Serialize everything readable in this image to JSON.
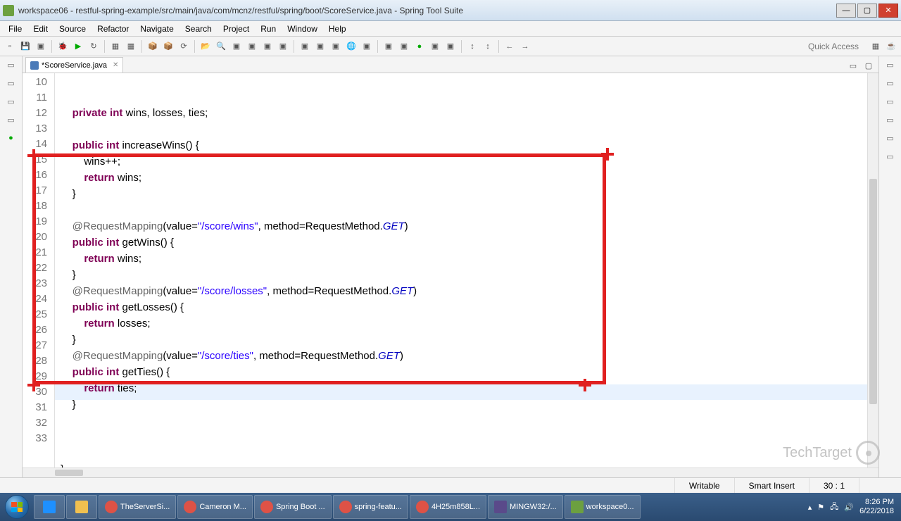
{
  "window": {
    "title": "workspace06 - restful-spring-example/src/main/java/com/mcnz/restful/spring/boot/ScoreService.java - Spring Tool Suite"
  },
  "menu": [
    "File",
    "Edit",
    "Source",
    "Refactor",
    "Navigate",
    "Search",
    "Project",
    "Run",
    "Window",
    "Help"
  ],
  "quick_access": "Quick Access",
  "tab": {
    "label": "*ScoreService.java"
  },
  "code": {
    "lines": [
      10,
      11,
      12,
      13,
      14,
      15,
      16,
      17,
      18,
      19,
      20,
      21,
      22,
      23,
      24,
      25,
      26,
      27,
      28,
      29,
      30,
      31,
      32,
      33
    ],
    "l10_a": "private",
    "l10_b": "int",
    "l10_c": " wins, losses, ties;",
    "l12_a": "public",
    "l12_b": "int",
    "l12_c": " increaseWins() {",
    "l13": "        wins++;",
    "l14_a": "return",
    "l14_b": " wins;",
    "l15": "    }",
    "l17_ann": "@RequestMapping",
    "l17_a": "(value=",
    "l17_s": "\"/score/wins\"",
    "l17_b": ", method=RequestMethod.",
    "l17_g": "GET",
    "l17_c": ")",
    "l18_a": "public",
    "l18_b": "int",
    "l18_c": " getWins() {",
    "l19_a": "return",
    "l19_b": " wins;",
    "l20": "    }",
    "l21_ann": "@RequestMapping",
    "l21_a": "(value=",
    "l21_s": "\"/score/losses\"",
    "l21_b": ", method=RequestMethod.",
    "l21_g": "GET",
    "l21_c": ")",
    "l22_a": "public",
    "l22_b": "int",
    "l22_c": " getLosses() {",
    "l23_a": "return",
    "l23_b": " losses;",
    "l24": "    }",
    "l25_ann": "@RequestMapping",
    "l25_a": "(value=",
    "l25_s": "\"/score/ties\"",
    "l25_b": ", method=RequestMethod.",
    "l25_g": "GET",
    "l25_c": ")",
    "l26_a": "public",
    "l26_b": "int",
    "l26_c": " getTies() {",
    "l27_a": "return",
    "l27_b": " ties;",
    "l28": "    }",
    "l32": "}"
  },
  "status": {
    "writable": "Writable",
    "insert": "Smart Insert",
    "pos": "30 : 1"
  },
  "taskbar": {
    "items": [
      {
        "label": "TheServerSi...",
        "color": "#de5246"
      },
      {
        "label": "Cameron M...",
        "color": "#de5246"
      },
      {
        "label": "Spring Boot ...",
        "color": "#de5246"
      },
      {
        "label": "spring-featu...",
        "color": "#de5246"
      },
      {
        "label": "4H25m858L...",
        "color": "#de5246"
      },
      {
        "label": "MINGW32:/...",
        "color": "#5a4a8a"
      },
      {
        "label": "workspace0...",
        "color": "#6ca040"
      }
    ],
    "time": "8:26 PM",
    "date": "6/22/2018"
  },
  "watermark": "TechTarget"
}
